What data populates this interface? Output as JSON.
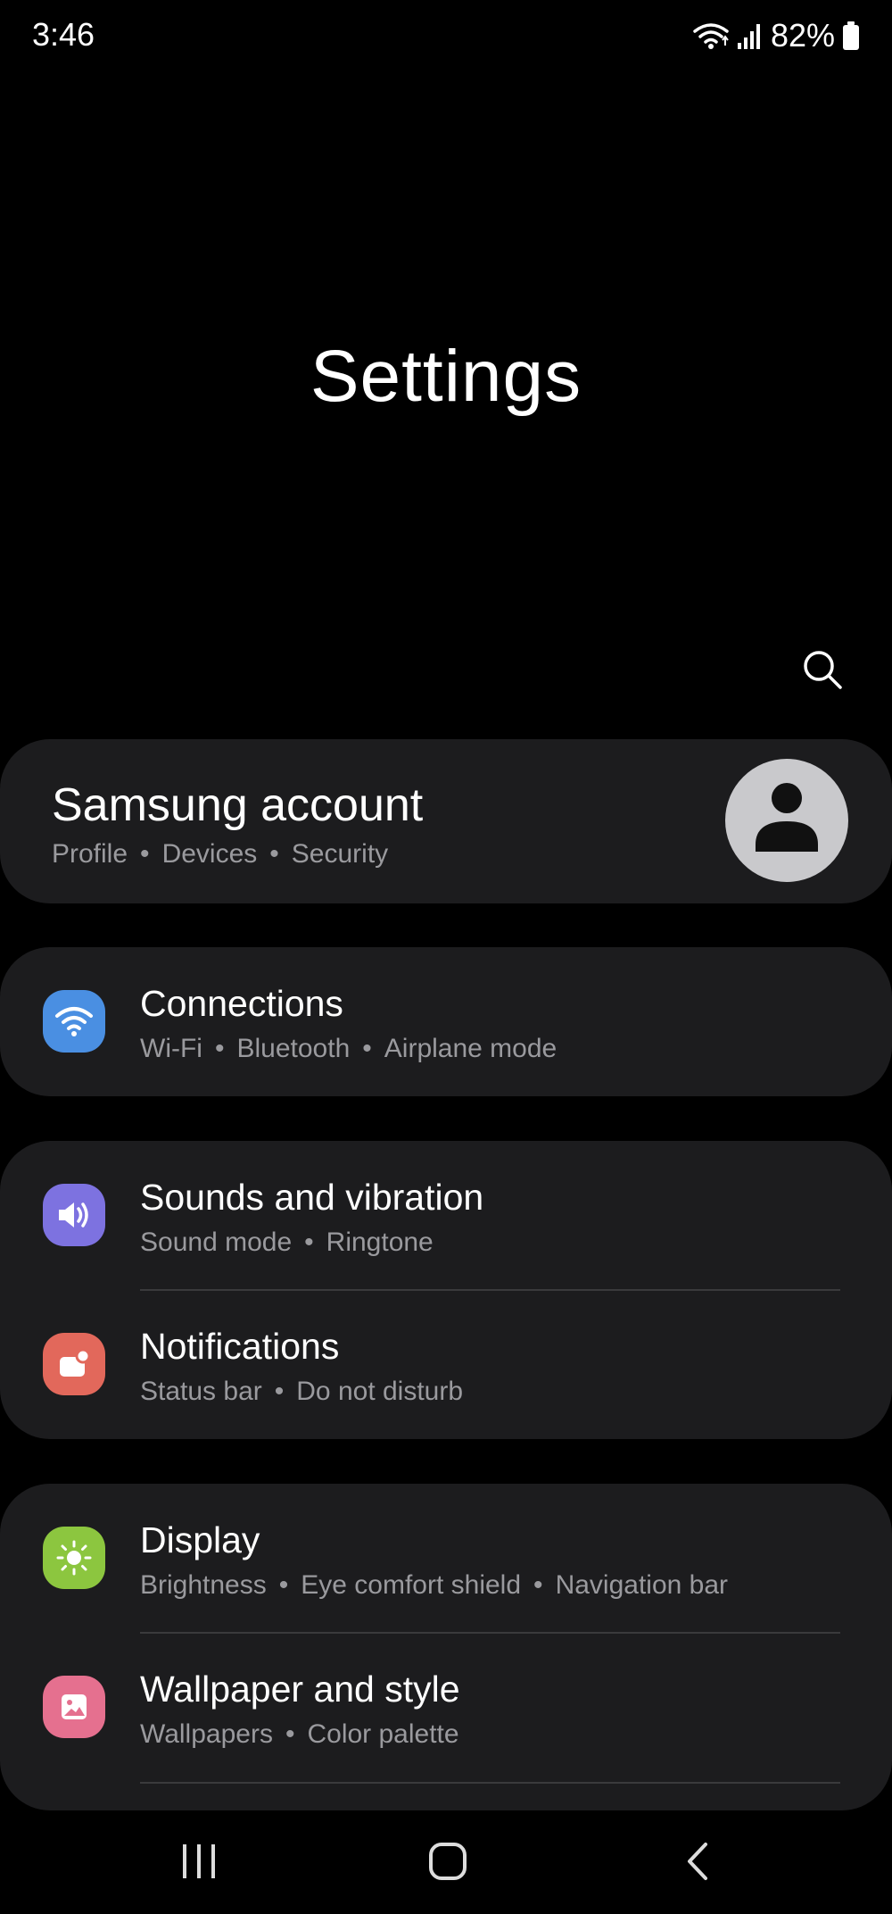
{
  "status_bar": {
    "time": "3:46",
    "battery_percent": "82%"
  },
  "page": {
    "title": "Settings"
  },
  "account": {
    "name": "Samsung account",
    "subs": [
      "Profile",
      "Devices",
      "Security"
    ]
  },
  "groups": [
    {
      "items": [
        {
          "title": "Connections",
          "subs": [
            "Wi-Fi",
            "Bluetooth",
            "Airplane mode"
          ],
          "icon": "wifi-icon",
          "color": "#4a8fe2"
        }
      ]
    },
    {
      "items": [
        {
          "title": "Sounds and vibration",
          "subs": [
            "Sound mode",
            "Ringtone"
          ],
          "icon": "speaker-icon",
          "color": "#7d72e0"
        },
        {
          "title": "Notifications",
          "subs": [
            "Status bar",
            "Do not disturb"
          ],
          "icon": "notification-icon",
          "color": "#e2685b"
        }
      ]
    },
    {
      "items": [
        {
          "title": "Display",
          "subs": [
            "Brightness",
            "Eye comfort shield",
            "Navigation bar"
          ],
          "icon": "sun-icon",
          "color": "#8cc63f"
        },
        {
          "title": "Wallpaper and style",
          "subs": [
            "Wallpapers",
            "Color palette"
          ],
          "icon": "image-icon",
          "color": "#e5708f"
        }
      ]
    }
  ],
  "nav_bar": {
    "buttons": [
      "recent-apps-icon",
      "home-icon",
      "back-icon"
    ]
  }
}
